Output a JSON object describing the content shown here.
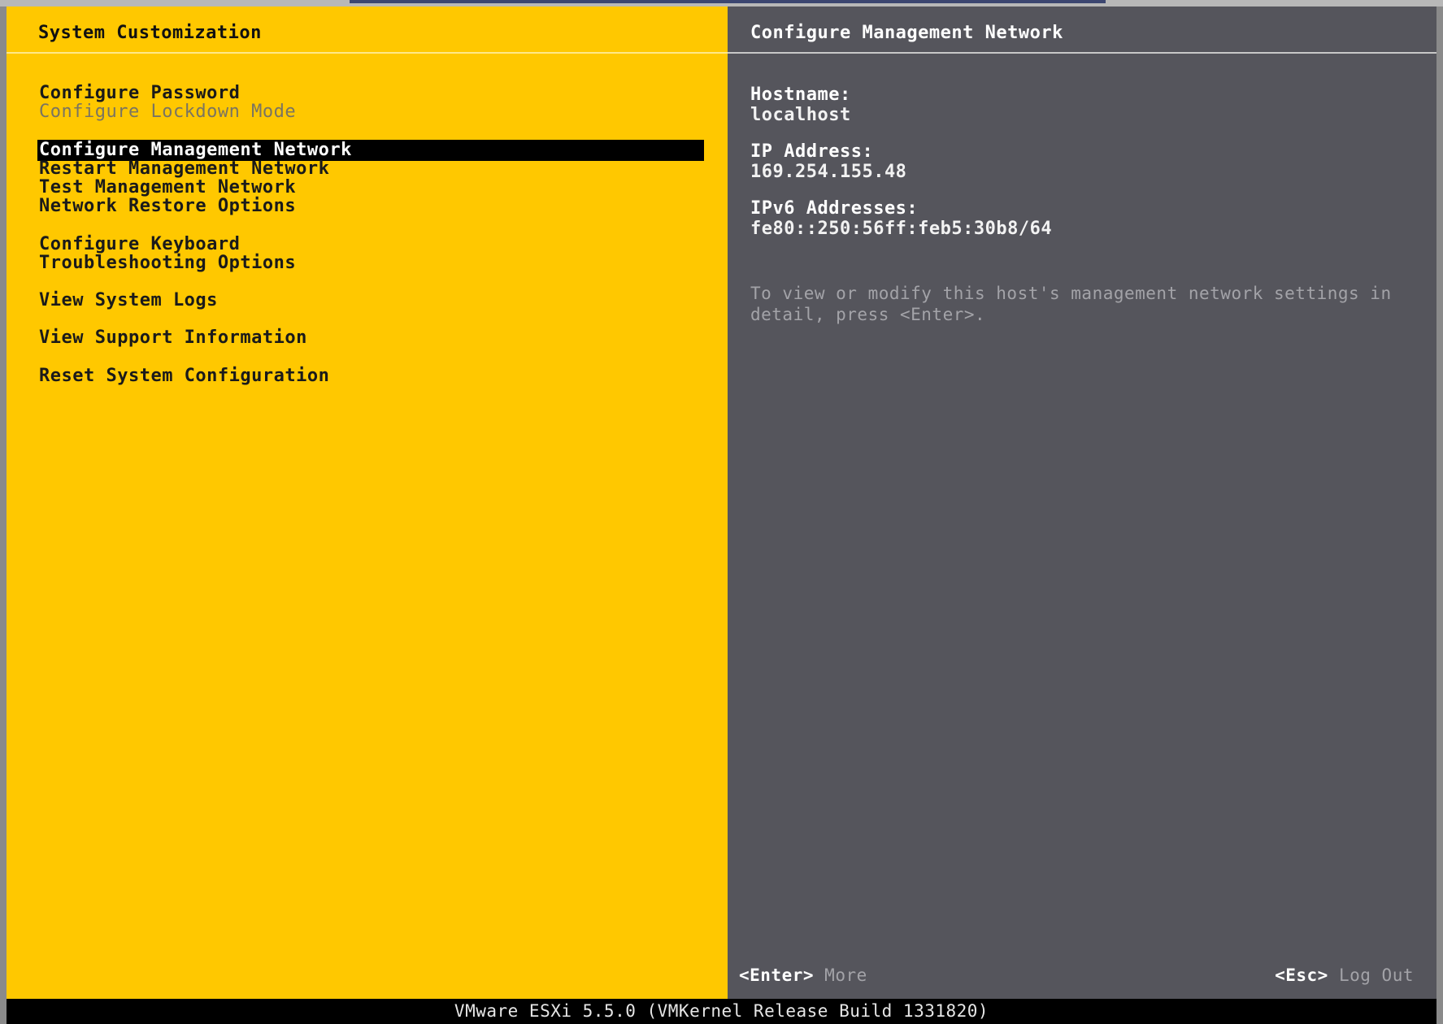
{
  "left_pane": {
    "title": "System Customization",
    "menu": [
      {
        "label": "Configure Password",
        "state": "normal"
      },
      {
        "label": "Configure Lockdown Mode",
        "state": "disabled"
      },
      {
        "label": "Configure Management Network",
        "state": "selected"
      },
      {
        "label": "Restart Management Network",
        "state": "normal"
      },
      {
        "label": "Test Management Network",
        "state": "normal"
      },
      {
        "label": "Network Restore Options",
        "state": "normal"
      },
      {
        "label": "Configure Keyboard",
        "state": "normal"
      },
      {
        "label": "Troubleshooting Options",
        "state": "normal"
      },
      {
        "label": "View System Logs",
        "state": "normal"
      },
      {
        "label": "View Support Information",
        "state": "normal"
      },
      {
        "label": "Reset System Configuration",
        "state": "normal"
      }
    ]
  },
  "right_pane": {
    "title": "Configure Management Network",
    "hostname_label": "Hostname:",
    "hostname_value": "localhost",
    "ip_label": "IP Address:",
    "ip_value": "169.254.155.48",
    "ipv6_label": "IPv6 Addresses:",
    "ipv6_value": "fe80::250:56ff:feb5:30b8/64",
    "hint": "To view or modify this host's management network settings in detail, press <Enter>."
  },
  "footer_keys": {
    "enter_key": "<Enter>",
    "enter_action": "More",
    "esc_key": "<Esc>",
    "esc_action": "Log Out"
  },
  "status_bar": {
    "text": "VMware ESXi 5.5.0 (VMKernel Release Build 1331820)"
  },
  "colors": {
    "left_pane_bg": "#ffc800",
    "right_pane_bg": "#55555c",
    "selection_bg": "#000000",
    "status_bar_bg": "#000000"
  }
}
